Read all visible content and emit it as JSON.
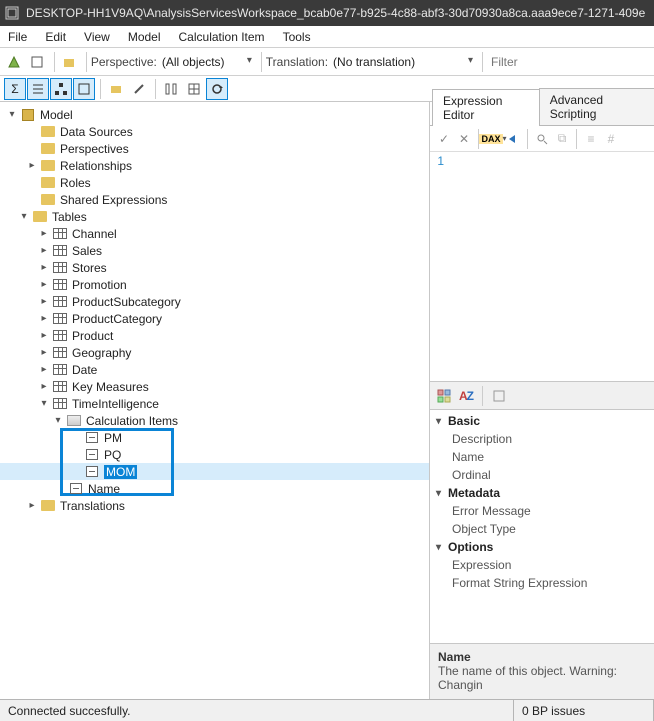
{
  "title": "DESKTOP-HH1V9AQ\\AnalysisServicesWorkspace_bcab0e77-b925-4c88-abf3-30d70930a8ca.aaa9ece7-1271-409e",
  "menu": [
    "File",
    "Edit",
    "View",
    "Model",
    "Calculation Item",
    "Tools"
  ],
  "toolbar": {
    "perspective_label": "Perspective:",
    "perspective_value": "(All objects)",
    "translation_label": "Translation:",
    "translation_value": "(No translation)",
    "filter_placeholder": "Filter"
  },
  "tree": {
    "root": "Model",
    "folders": [
      "Data Sources",
      "Perspectives",
      "Relationships",
      "Roles",
      "Shared Expressions"
    ],
    "tables_label": "Tables",
    "tables": [
      "Channel",
      "Sales",
      "Stores",
      "Promotion",
      "ProductSubcategory",
      "ProductCategory",
      "Product",
      "Geography",
      "Date",
      "Key Measures"
    ],
    "ti_table": "TimeIntelligence",
    "calcitems_label": "Calculation Items",
    "calcitems": [
      "PM",
      "PQ",
      "MOM"
    ],
    "name_row": "Name",
    "translations_label": "Translations"
  },
  "right": {
    "tabs": [
      "Expression Editor",
      "Advanced Scripting"
    ],
    "dax_label": "DAX",
    "line_no": "1",
    "prop_groups": {
      "basic": {
        "h": "Basic",
        "items": [
          "Description",
          "Name",
          "Ordinal"
        ]
      },
      "metadata": {
        "h": "Metadata",
        "items": [
          "Error Message",
          "Object Type"
        ]
      },
      "options": {
        "h": "Options",
        "items": [
          "Expression",
          "Format String Expression"
        ]
      }
    },
    "help_name": "Name",
    "help_desc": "The name of this object. Warning: Changin"
  },
  "status": {
    "left": "Connected succesfully.",
    "right": "0 BP issues"
  }
}
